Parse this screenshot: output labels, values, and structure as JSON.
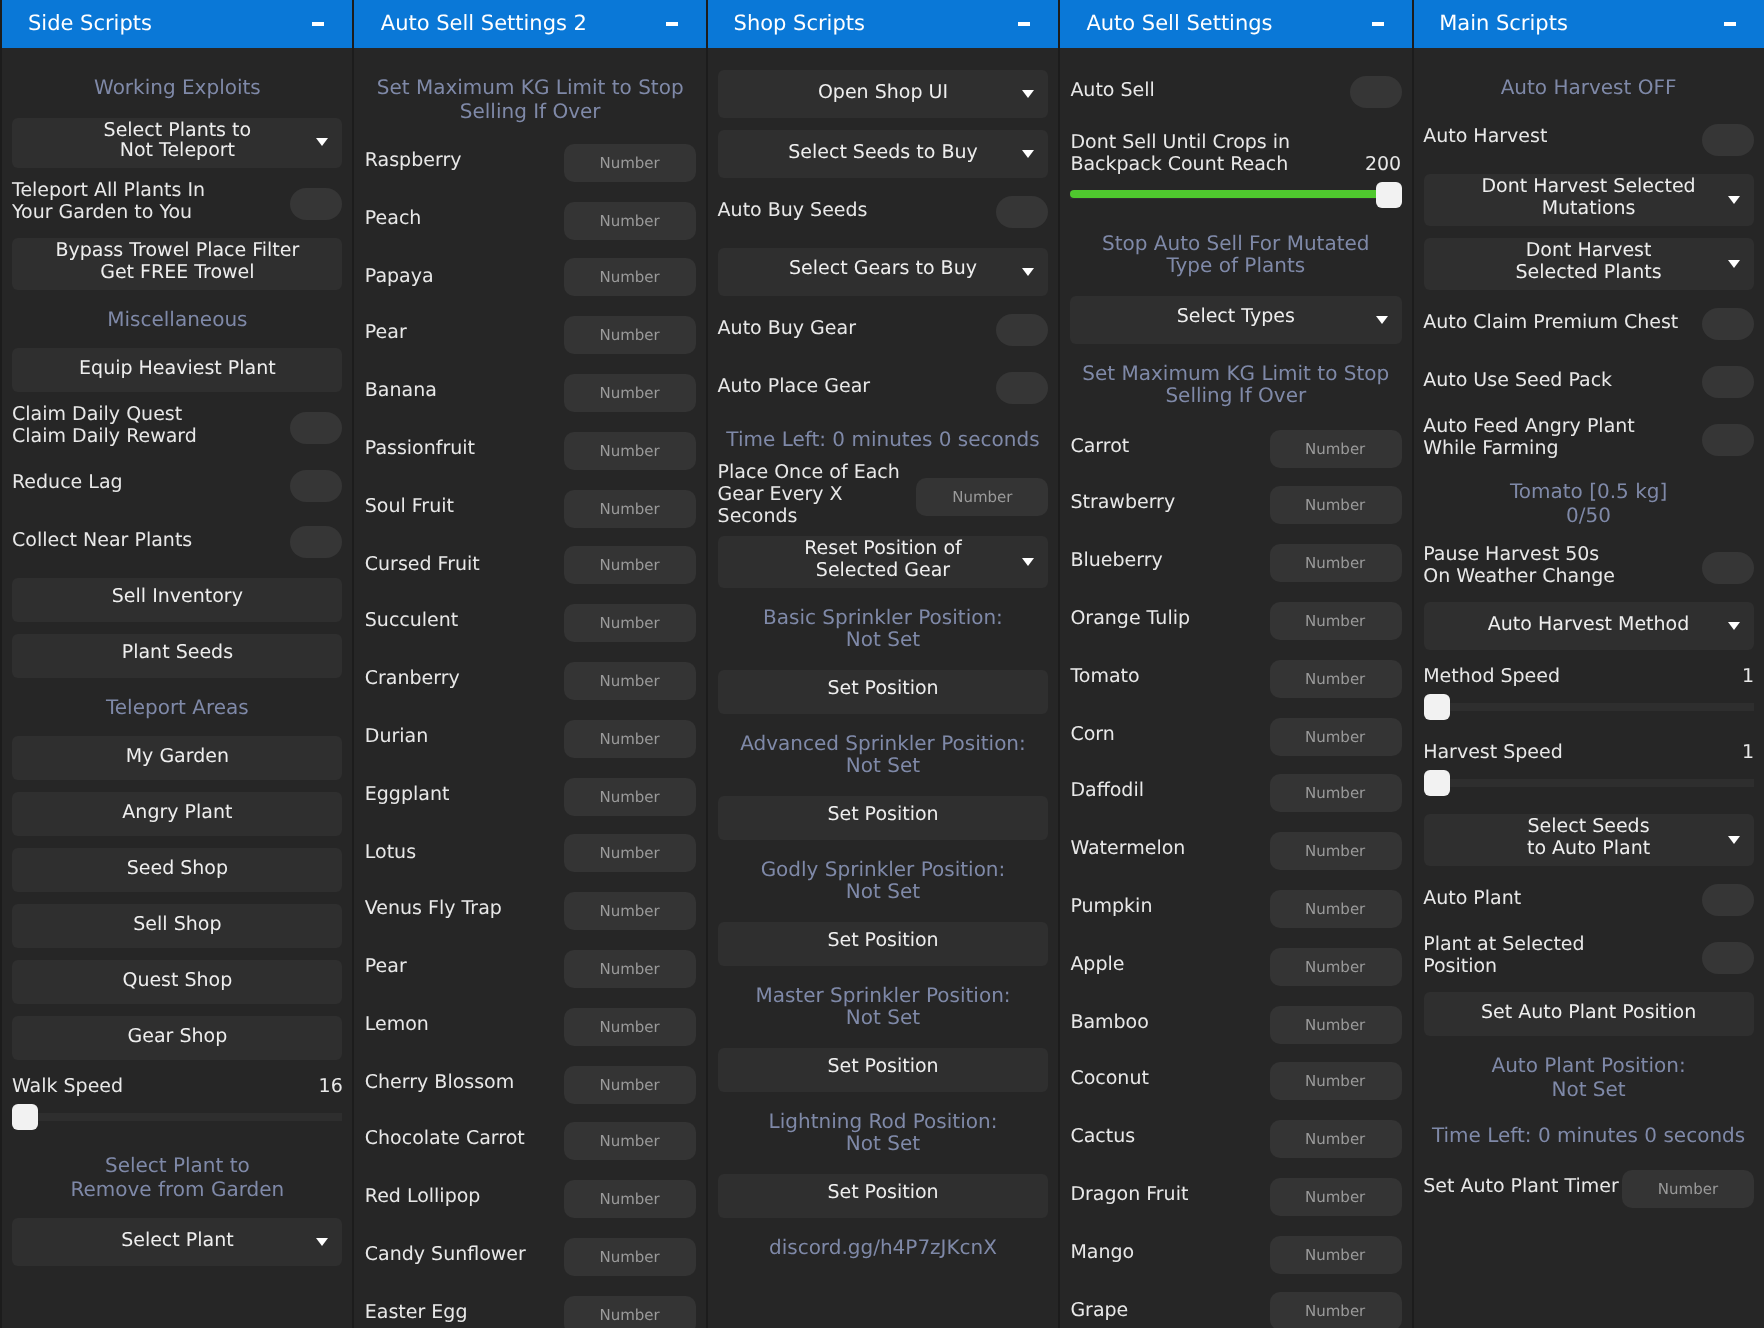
{
  "panels": [
    {
      "title": "Side Scripts",
      "items": [
        {
          "kind": "heading",
          "text": "Working Exploits"
        },
        {
          "kind": "dropdown",
          "label": "Select Plants to\nNot Teleport"
        },
        {
          "kind": "toggle",
          "label": "Teleport All Plants In\nYour Garden to You",
          "on": false
        },
        {
          "kind": "button",
          "label": "Bypass Trowel Place Filter\nGet FREE Trowel"
        },
        {
          "kind": "heading",
          "text": "Miscellaneous"
        },
        {
          "kind": "button",
          "label": "Equip Heaviest Plant"
        },
        {
          "kind": "toggle",
          "label": "Claim Daily Quest\nClaim Daily Reward",
          "on": false
        },
        {
          "kind": "toggle",
          "label": "Reduce Lag",
          "on": false
        },
        {
          "kind": "toggle",
          "label": "Collect Near Plants",
          "on": false
        },
        {
          "kind": "button",
          "label": "Sell Inventory"
        },
        {
          "kind": "button",
          "label": "Plant Seeds"
        },
        {
          "kind": "heading",
          "text": "Teleport Areas"
        },
        {
          "kind": "button",
          "label": "My Garden"
        },
        {
          "kind": "button",
          "label": "Angry Plant"
        },
        {
          "kind": "button",
          "label": "Seed Shop"
        },
        {
          "kind": "button",
          "label": "Sell Shop"
        },
        {
          "kind": "button",
          "label": "Quest Shop"
        },
        {
          "kind": "button",
          "label": "Gear Shop"
        },
        {
          "kind": "slider",
          "label": "Walk Speed",
          "reading": "16",
          "level": 0
        },
        {
          "kind": "heading",
          "text": "Select Plant to\nRemove from Garden"
        },
        {
          "kind": "dropdown",
          "label": "Select Plant"
        }
      ]
    },
    {
      "title": "Auto Sell Settings 2",
      "items": [
        {
          "kind": "heading",
          "text": "Set Maximum KG Limit to Stop\nSelling If Over"
        },
        {
          "kind": "number",
          "label": "Raspberry",
          "placeholder": "Number"
        },
        {
          "kind": "number",
          "label": "Peach",
          "placeholder": "Number"
        },
        {
          "kind": "number",
          "label": "Papaya",
          "placeholder": "Number"
        },
        {
          "kind": "number",
          "label": "Pear",
          "placeholder": "Number"
        },
        {
          "kind": "number",
          "label": "Banana",
          "placeholder": "Number"
        },
        {
          "kind": "number",
          "label": "Passionfruit",
          "placeholder": "Number"
        },
        {
          "kind": "number",
          "label": "Soul Fruit",
          "placeholder": "Number"
        },
        {
          "kind": "number",
          "label": "Cursed Fruit",
          "placeholder": "Number"
        },
        {
          "kind": "number",
          "label": "Succulent",
          "placeholder": "Number"
        },
        {
          "kind": "number",
          "label": "Cranberry",
          "placeholder": "Number"
        },
        {
          "kind": "number",
          "label": "Durian",
          "placeholder": "Number"
        },
        {
          "kind": "number",
          "label": "Eggplant",
          "placeholder": "Number"
        },
        {
          "kind": "number",
          "label": "Lotus",
          "placeholder": "Number"
        },
        {
          "kind": "number",
          "label": "Venus Fly Trap",
          "placeholder": "Number"
        },
        {
          "kind": "number",
          "label": "Pear",
          "placeholder": "Number"
        },
        {
          "kind": "number",
          "label": "Lemon",
          "placeholder": "Number"
        },
        {
          "kind": "number",
          "label": "Cherry Blossom",
          "placeholder": "Number"
        },
        {
          "kind": "number",
          "label": "Chocolate Carrot",
          "placeholder": "Number"
        },
        {
          "kind": "number",
          "label": "Red Lollipop",
          "placeholder": "Number"
        },
        {
          "kind": "number",
          "label": "Candy Sunflower",
          "placeholder": "Number"
        },
        {
          "kind": "number",
          "label": "Easter Egg",
          "placeholder": "Number"
        }
      ]
    },
    {
      "title": "Shop Scripts",
      "items": [
        {
          "kind": "dropdown",
          "label": "Open Shop UI"
        },
        {
          "kind": "dropdown",
          "label": "Select Seeds to Buy"
        },
        {
          "kind": "toggle",
          "label": "Auto Buy Seeds",
          "on": false
        },
        {
          "kind": "dropdown",
          "label": "Select Gears to Buy"
        },
        {
          "kind": "toggle",
          "label": "Auto Buy Gear",
          "on": false
        },
        {
          "kind": "toggle",
          "label": "Auto Place Gear",
          "on": false
        },
        {
          "kind": "heading",
          "text": "Time Left: 0 minutes 0 seconds"
        },
        {
          "kind": "number",
          "label": "Place Once of Each\nGear Every X Seconds",
          "placeholder": "Number"
        },
        {
          "kind": "dropdown",
          "label": "Reset Position of\nSelected Gear"
        },
        {
          "kind": "heading",
          "text": "Basic Sprinkler Position:\nNot Set"
        },
        {
          "kind": "button",
          "label": "Set Position"
        },
        {
          "kind": "heading",
          "text": "Advanced Sprinkler Position:\nNot Set"
        },
        {
          "kind": "button",
          "label": "Set Position"
        },
        {
          "kind": "heading",
          "text": "Godly Sprinkler Position:\nNot Set"
        },
        {
          "kind": "button",
          "label": "Set Position"
        },
        {
          "kind": "heading",
          "text": "Master Sprinkler Position:\nNot Set"
        },
        {
          "kind": "button",
          "label": "Set Position"
        },
        {
          "kind": "heading",
          "text": "Lightning Rod Position:\nNot Set"
        },
        {
          "kind": "button",
          "label": "Set Position"
        },
        {
          "kind": "heading",
          "text": "discord.gg/h4P7zJKcnX"
        }
      ]
    },
    {
      "title": "Auto Sell Settings",
      "items": [
        {
          "kind": "toggle",
          "label": "Auto Sell",
          "on": false
        },
        {
          "kind": "slider",
          "label": "Dont Sell Until Crops in\nBackpack Count Reach",
          "reading": "200",
          "level": 1
        },
        {
          "kind": "heading",
          "text": "Stop Auto Sell For Mutated\nType of Plants"
        },
        {
          "kind": "dropdown",
          "label": "Select Types"
        },
        {
          "kind": "heading",
          "text": "Set Maximum KG Limit to Stop\nSelling If Over"
        },
        {
          "kind": "number",
          "label": "Carrot",
          "placeholder": "Number"
        },
        {
          "kind": "number",
          "label": "Strawberry",
          "placeholder": "Number"
        },
        {
          "kind": "number",
          "label": "Blueberry",
          "placeholder": "Number"
        },
        {
          "kind": "number",
          "label": "Orange Tulip",
          "placeholder": "Number"
        },
        {
          "kind": "number",
          "label": "Tomato",
          "placeholder": "Number"
        },
        {
          "kind": "number",
          "label": "Corn",
          "placeholder": "Number"
        },
        {
          "kind": "number",
          "label": "Daffodil",
          "placeholder": "Number"
        },
        {
          "kind": "number",
          "label": "Watermelon",
          "placeholder": "Number"
        },
        {
          "kind": "number",
          "label": "Pumpkin",
          "placeholder": "Number"
        },
        {
          "kind": "number",
          "label": "Apple",
          "placeholder": "Number"
        },
        {
          "kind": "number",
          "label": "Bamboo",
          "placeholder": "Number"
        },
        {
          "kind": "number",
          "label": "Coconut",
          "placeholder": "Number"
        },
        {
          "kind": "number",
          "label": "Cactus",
          "placeholder": "Number"
        },
        {
          "kind": "number",
          "label": "Dragon Fruit",
          "placeholder": "Number"
        },
        {
          "kind": "number",
          "label": "Mango",
          "placeholder": "Number"
        },
        {
          "kind": "number",
          "label": "Grape",
          "placeholder": "Number"
        }
      ]
    },
    {
      "title": "Main Scripts",
      "items": [
        {
          "kind": "heading",
          "text": "Auto Harvest OFF"
        },
        {
          "kind": "toggle",
          "label": "Auto Harvest",
          "on": false
        },
        {
          "kind": "dropdown",
          "label": "Dont Harvest Selected\nMutations"
        },
        {
          "kind": "dropdown",
          "label": "Dont Harvest\nSelected Plants"
        },
        {
          "kind": "toggle",
          "label": "Auto Claim Premium Chest",
          "on": false
        },
        {
          "kind": "toggle",
          "label": "Auto Use Seed Pack",
          "on": false
        },
        {
          "kind": "toggle",
          "label": "Auto Feed Angry Plant\nWhile Farming",
          "on": false
        },
        {
          "kind": "heading",
          "text": "Tomato [0.5 kg]\n0/50"
        },
        {
          "kind": "toggle",
          "label": "Pause Harvest 50s\nOn Weather Change",
          "on": false
        },
        {
          "kind": "dropdown",
          "label": "Auto Harvest Method"
        },
        {
          "kind": "slider",
          "label": "Method Speed",
          "reading": "1",
          "level": 0
        },
        {
          "kind": "slider",
          "label": "Harvest Speed",
          "reading": "1",
          "level": 0
        },
        {
          "kind": "dropdown",
          "label": "Select Seeds\nto Auto Plant"
        },
        {
          "kind": "toggle",
          "label": "Auto Plant",
          "on": false
        },
        {
          "kind": "toggle",
          "label": "Plant at Selected\nPosition",
          "on": false
        },
        {
          "kind": "button",
          "label": "Set Auto Plant Position"
        },
        {
          "kind": "heading",
          "text": "Auto Plant Position:\nNot Set"
        },
        {
          "kind": "heading",
          "text": "Time Left: 0 minutes 0 seconds"
        },
        {
          "kind": "number",
          "label": "Set Auto Plant Timer",
          "placeholder": "Number"
        }
      ]
    }
  ]
}
